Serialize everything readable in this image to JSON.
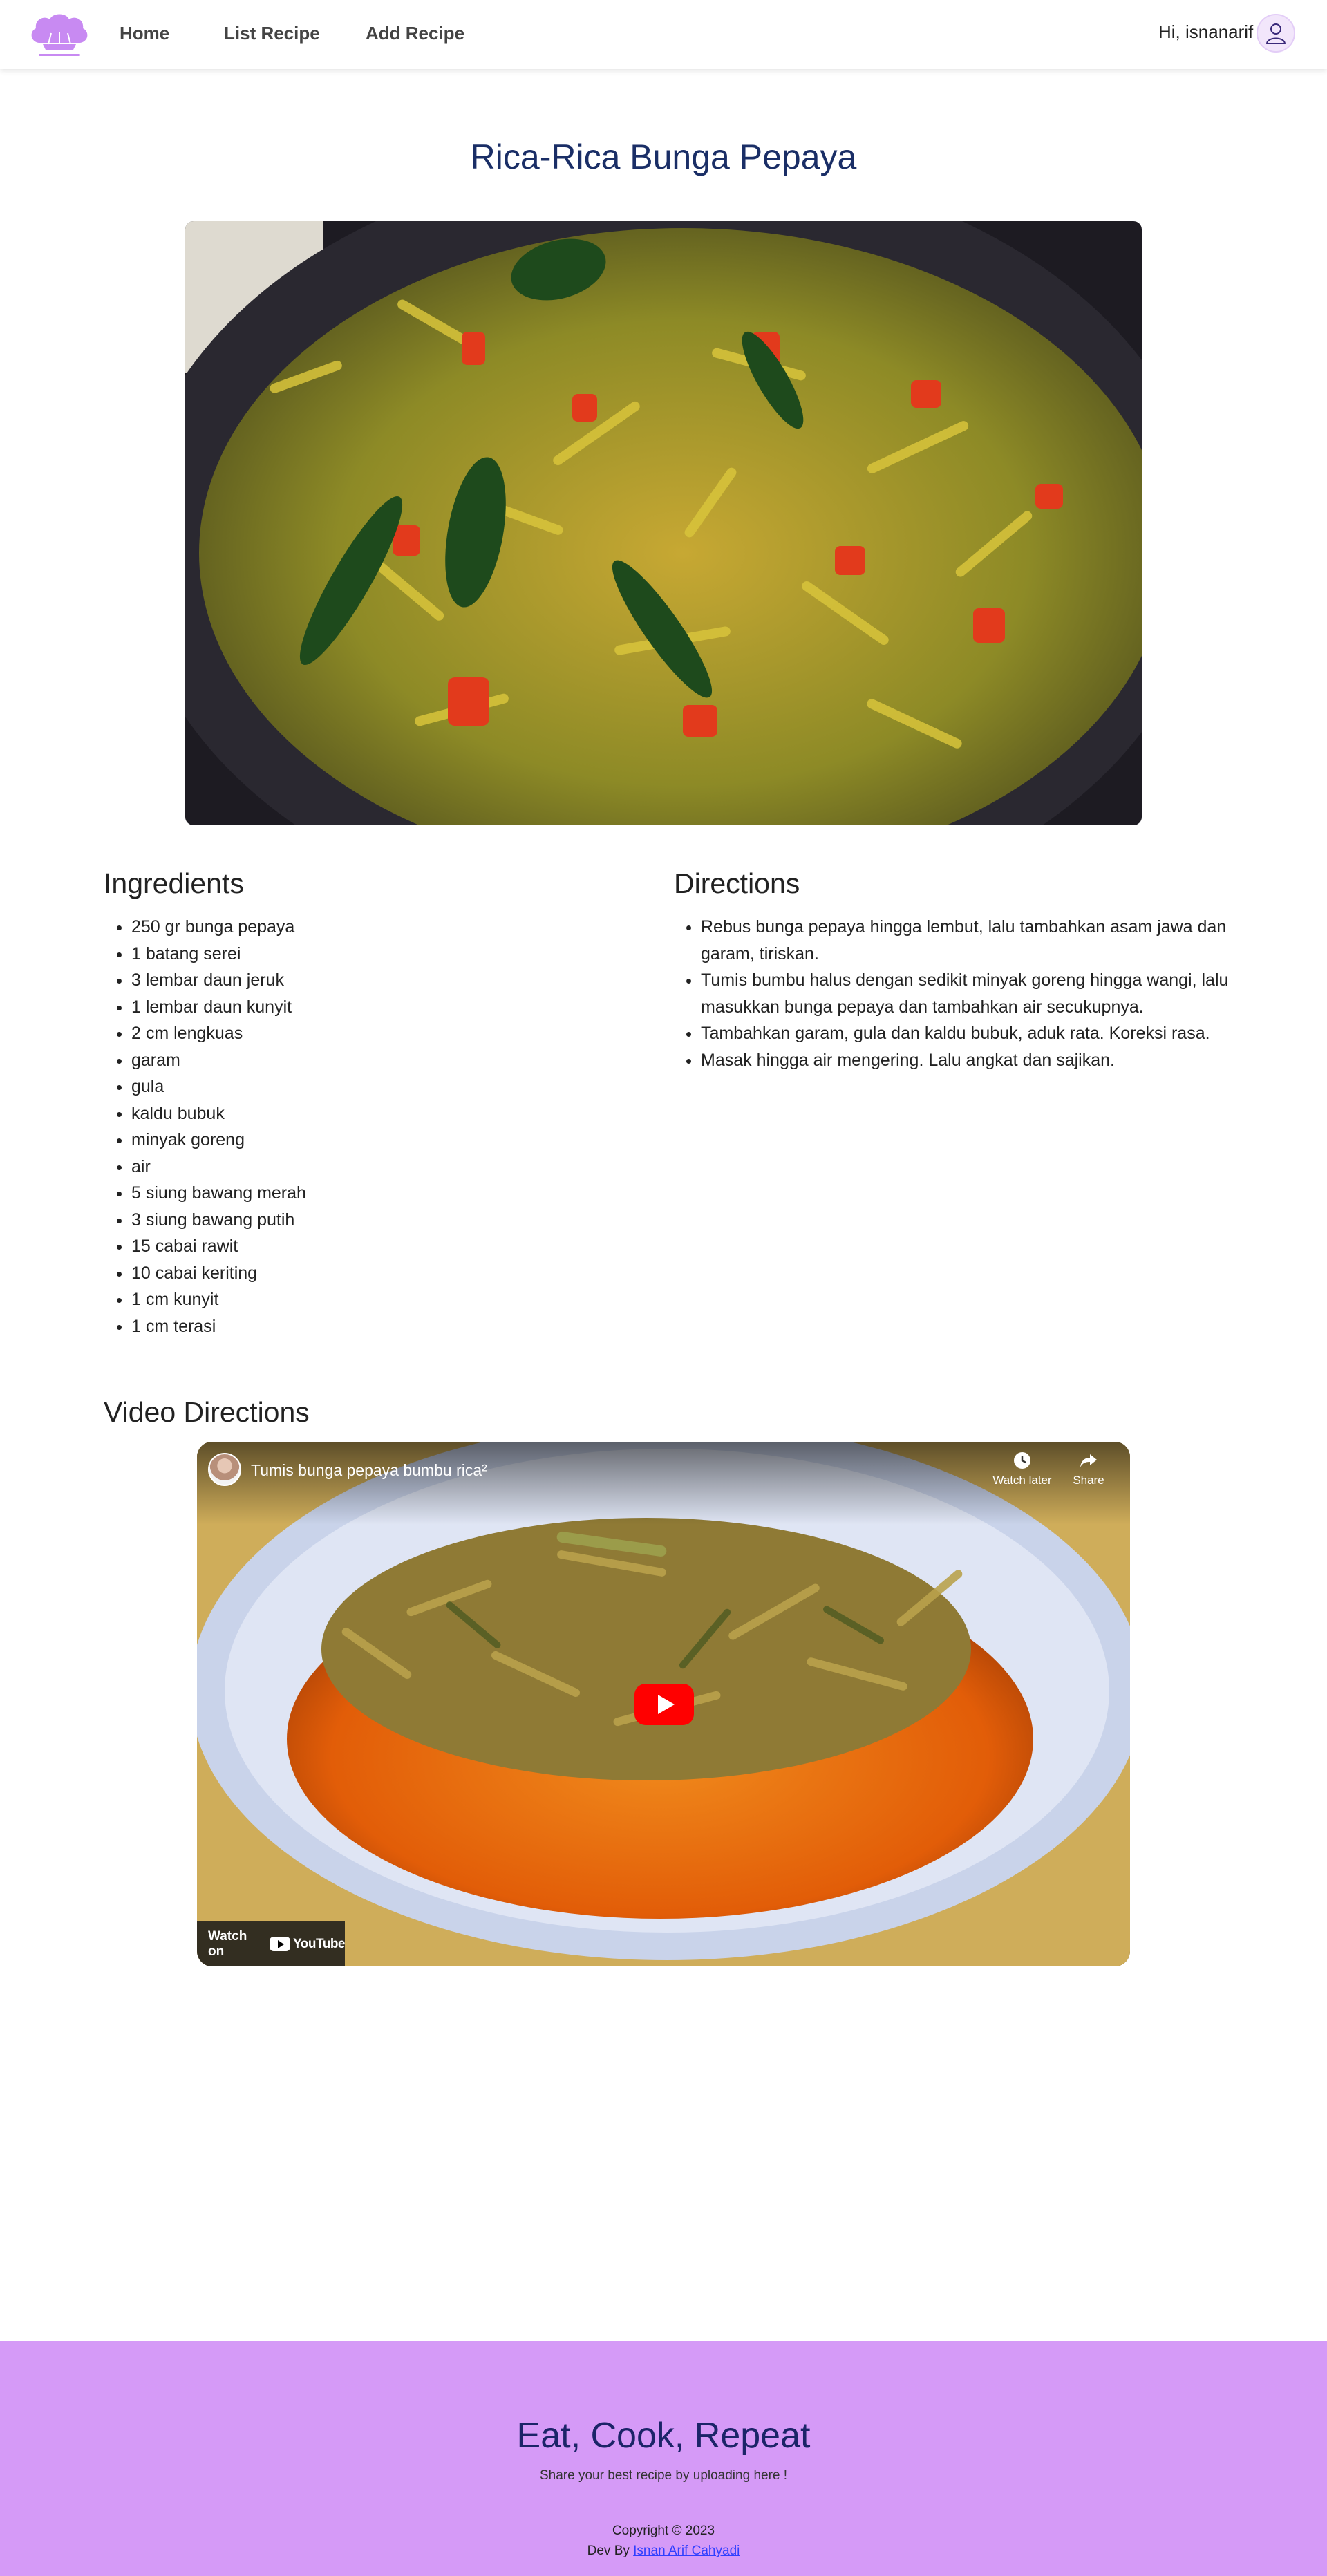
{
  "navbar": {
    "links": [
      {
        "label": "Home"
      },
      {
        "label": "List Recipe"
      },
      {
        "label": "Add Recipe"
      }
    ],
    "greeting": "Hi, isnanarif"
  },
  "recipe": {
    "title": "Rica-Rica Bunga Pepaya"
  },
  "ingredients": {
    "heading": "Ingredients",
    "items": [
      "250 gr bunga pepaya",
      "1 batang serei",
      "3 lembar daun jeruk",
      "1 lembar daun kunyit",
      "2 cm lengkuas",
      "garam",
      "gula",
      "kaldu bubuk",
      "minyak goreng",
      "air",
      "5 siung bawang merah",
      "3 siung bawang putih",
      "15 cabai rawit",
      "10 cabai keriting",
      "1 cm kunyit",
      "1 cm terasi"
    ]
  },
  "directions": {
    "heading": "Directions",
    "items": [
      "Rebus bunga pepaya hingga lembut, lalu tambahkan asam jawa dan garam, tiriskan.",
      "Tumis bumbu halus dengan sedikit minyak goreng hingga wangi, lalu masukkan bunga pepaya dan tambahkan air secukupnya.",
      "Tambahkan garam, gula dan kaldu bubuk, aduk rata. Koreksi rasa.",
      "Masak hingga air mengering. Lalu angkat dan sajikan."
    ]
  },
  "video": {
    "heading": "Video Directions",
    "title": "Tumis bunga pepaya bumbu rica²",
    "watch_later": "Watch later",
    "share": "Share",
    "watch_on": "Watch on",
    "youtube": "YouTube"
  },
  "footer": {
    "title": "Eat, Cook, Repeat",
    "subtitle": "Share your best recipe by uploading here !",
    "copyright": "Copyright © 2023",
    "dev_prefix": "Dev By",
    "dev_name": "Isnan Arif Cahyadi"
  },
  "colors": {
    "accent": "#d59af7",
    "title": "#1a2e66"
  }
}
